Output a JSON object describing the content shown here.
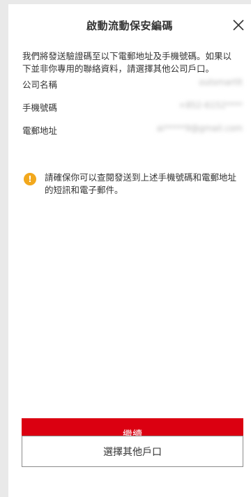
{
  "dialog": {
    "title": "啟動流動保安編碼",
    "close_icon": "close-icon",
    "intro_text": "我們將發送驗證碼至以下電郵地址及手機號碼。如果以下並非你專用的聯絡資料，請選擇其他公司戶口。"
  },
  "details": [
    {
      "label": "公司名稱",
      "value": "outsmartlt"
    },
    {
      "label": "手機號碼",
      "value": "+852-6152****"
    },
    {
      "label": "電郵地址",
      "value": "ai*****9@gmail.com"
    }
  ],
  "notice": {
    "icon": "warning-icon",
    "icon_glyph": "!",
    "icon_color": "#f2a81d",
    "text": "請確保你可以查閱發送到上述手機號碼和電郵地址的短訊和電子郵件。"
  },
  "actions": {
    "continue_label": "繼續",
    "continue_color": "#db0011",
    "other_account_label": "選擇其他戶口"
  }
}
